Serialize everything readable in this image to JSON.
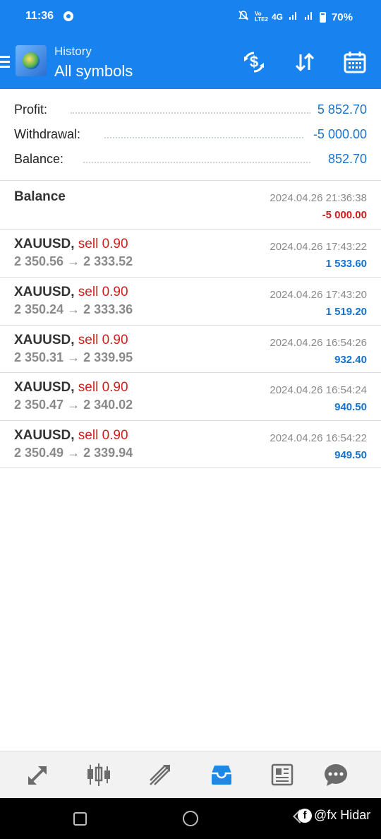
{
  "status_bar": {
    "time": "11:36",
    "network": "4G",
    "volte": "Vo LTE2",
    "battery": "70%"
  },
  "header": {
    "subtitle": "History",
    "title": "All symbols",
    "actions": [
      "dollar-refresh-icon",
      "sort-icon",
      "calendar-icon"
    ],
    "menu_icon": "hamburger-menu-icon"
  },
  "summary": [
    {
      "label": "Profit:",
      "value": "5 852.70"
    },
    {
      "label": "Withdrawal:",
      "value": "-5 000.00"
    },
    {
      "label": "Balance:",
      "value": "852.70"
    }
  ],
  "balance_entry": {
    "title": "Balance",
    "date": "2024.04.26 21:36:38",
    "amount": "-5 000.00"
  },
  "deals": [
    {
      "symbol": "XAUUSD,",
      "side": "sell 0.90",
      "prices": "2 350.56 → 2 333.52",
      "date": "2024.04.26 17:43:22",
      "profit": "1 533.60"
    },
    {
      "symbol": "XAUUSD,",
      "side": "sell 0.90",
      "prices": "2 350.24 → 2 333.36",
      "date": "2024.04.26 17:43:20",
      "profit": "1 519.20"
    },
    {
      "symbol": "XAUUSD,",
      "side": "sell 0.90",
      "prices": "2 350.31 → 2 339.95",
      "date": "2024.04.26 16:54:26",
      "profit": "932.40"
    },
    {
      "symbol": "XAUUSD,",
      "side": "sell 0.90",
      "prices": "2 350.47 → 2 340.02",
      "date": "2024.04.26 16:54:24",
      "profit": "940.50"
    },
    {
      "symbol": "XAUUSD,",
      "side": "sell 0.90",
      "prices": "2 350.49 → 2 339.94",
      "date": "2024.04.26 16:54:22",
      "profit": "949.50"
    }
  ],
  "bottom_nav": {
    "items": [
      "quotes-icon",
      "chart-icon",
      "trade-icon",
      "history-icon",
      "news-icon",
      "messages-icon"
    ],
    "active": "history-icon"
  },
  "watermark": {
    "text": "@fx Hidar"
  },
  "colors": {
    "brand_blue": "#1883ee",
    "profit_blue": "#1a73c8",
    "loss_red": "#d01f1f",
    "active_tab": "#1e88e5"
  }
}
